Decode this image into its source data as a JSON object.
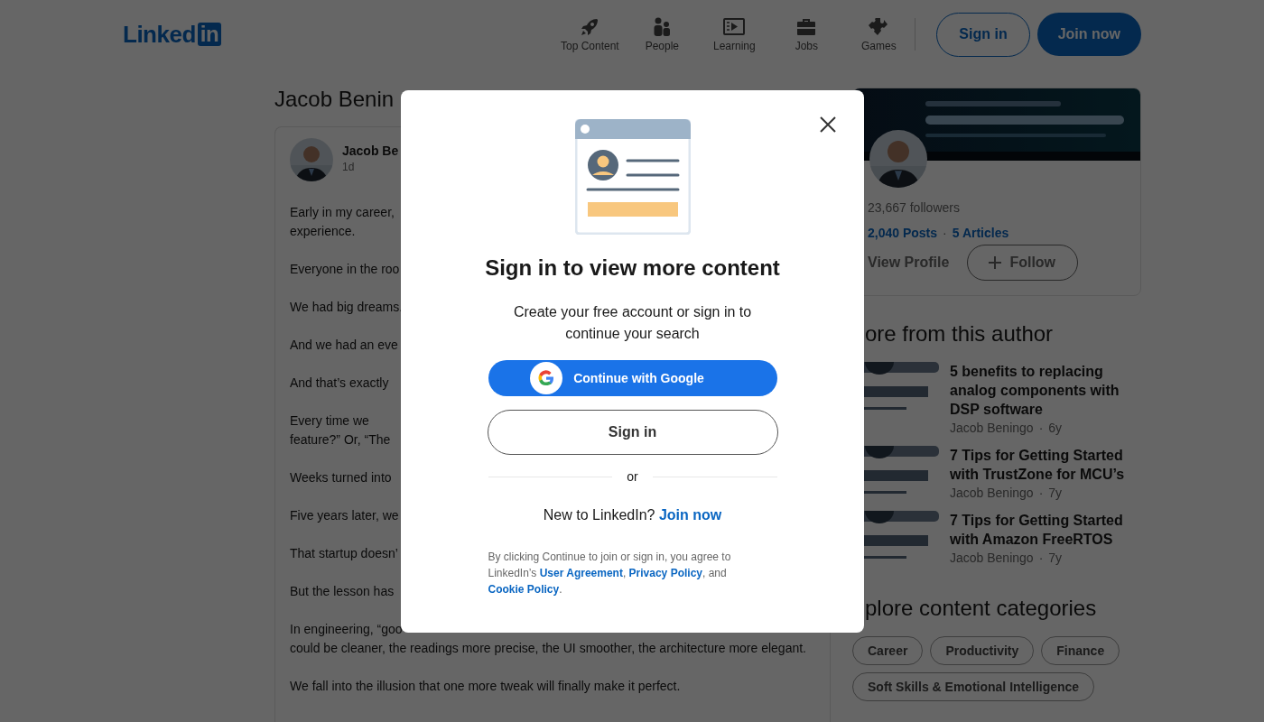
{
  "header": {
    "logo": {
      "text": "Linked",
      "badge": "in"
    },
    "nav": [
      {
        "label": "Top Content"
      },
      {
        "label": "People"
      },
      {
        "label": "Learning"
      },
      {
        "label": "Jobs"
      },
      {
        "label": "Games"
      }
    ],
    "sign_in": "Sign in",
    "join_now": "Join now"
  },
  "article": {
    "title": "Jacob Benin",
    "author": "Jacob Be",
    "time": "1d",
    "paragraphs": [
      [
        "Early in my career,",
        "experience."
      ],
      [
        "Everyone in the roo"
      ],
      [
        "We had big dreams."
      ],
      [
        "And we had an eve"
      ],
      [
        "And that’s exactly"
      ],
      [
        "Every time we",
        "feature?” Or, “The"
      ],
      [
        "Weeks turned into"
      ],
      [
        "Five years later, we"
      ],
      [
        "That startup doesn’"
      ],
      [
        "But the lesson has"
      ],
      [
        "In engineering, “goo",
        "could be cleaner, the readings more precise, the UI smoother, the architecture more elegant."
      ],
      [
        "We fall into the illusion that one more tweak will finally make it perfect."
      ]
    ]
  },
  "sidebar": {
    "profile": {
      "followers": "23,667 followers",
      "posts": "2,040 Posts",
      "separator": "·",
      "articles": "5 Articles",
      "view_profile": "View Profile",
      "follow": "Follow"
    },
    "more_heading": "ore from this author",
    "more": [
      {
        "title": "5 benefits to replacing analog components with DSP software",
        "author": "Jacob Beningo",
        "separator": "·",
        "age": "6y"
      },
      {
        "title": "7 Tips for Getting Started with TrustZone for MCU’s",
        "author": "Jacob Beningo",
        "separator": "·",
        "age": "7y"
      },
      {
        "title": "7 Tips for Getting Started with Amazon FreeRTOS",
        "author": "Jacob Beningo",
        "separator": "·",
        "age": "7y"
      }
    ],
    "categories_heading": "plore content categories",
    "categories": [
      "Career",
      "Productivity",
      "Finance",
      "Soft Skills & Emotional Intelligence"
    ]
  },
  "modal": {
    "title": "Sign in to view more content",
    "subtitle": "Create your free account or sign in to continue your search",
    "google_button": "Continue with Google",
    "sign_in_button": "Sign in",
    "divider": "or",
    "new_prompt": "New to LinkedIn?",
    "join_link": "Join now",
    "legal": [
      {
        "kind": "text",
        "text": "By clicking Continue to join or sign in, you agree to LinkedIn’s "
      },
      {
        "kind": "link",
        "text": "User Agreement"
      },
      {
        "kind": "text",
        "text": ", "
      },
      {
        "kind": "link",
        "text": "Privacy Policy"
      },
      {
        "kind": "text",
        "text": ", and "
      },
      {
        "kind": "link",
        "text": "Cookie Policy"
      },
      {
        "kind": "text",
        "text": "."
      }
    ]
  }
}
